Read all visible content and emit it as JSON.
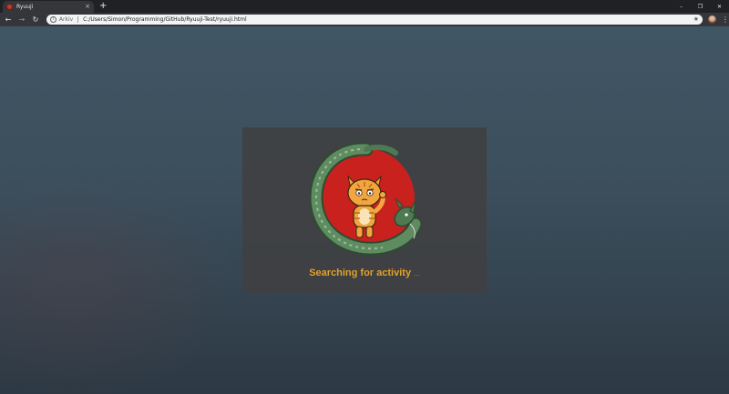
{
  "browser": {
    "tab_title": "Ryuuji",
    "tab_close": "×",
    "new_tab": "+",
    "window_controls": {
      "minimize": "–",
      "maximize": "❐",
      "close": "✕"
    },
    "nav": {
      "back": "←",
      "forward": "→",
      "reload": "↻"
    },
    "address": {
      "scheme_label": "Arkiv",
      "url": "C:/Users/Simon/Programming/GitHub/Ryuuji-Test/ryuuji.html"
    },
    "icons": {
      "info": "info-icon",
      "bookmark": "star-icon",
      "profile": "avatar",
      "menu": "kebab-menu-icon"
    }
  },
  "page": {
    "status_text": "Searching for activity",
    "status_dots": "...",
    "colors": {
      "status": "#e3a02a",
      "card_bg": "#404042",
      "sun": "#c8211e",
      "dragon": "#4e7a52",
      "cat": "#f2a640"
    }
  }
}
